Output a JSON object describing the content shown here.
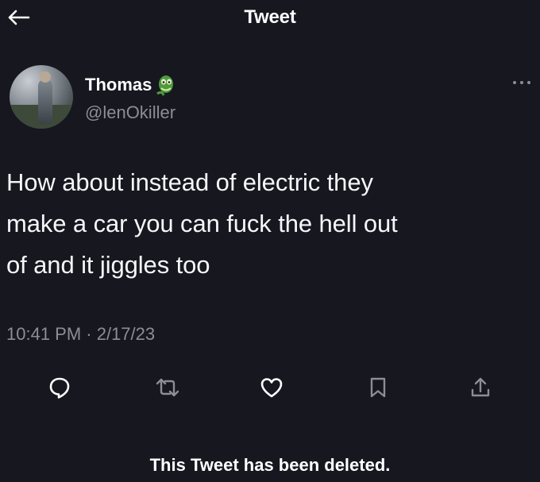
{
  "header": {
    "title": "Tweet",
    "back_icon": "arrow-left-icon"
  },
  "author": {
    "name": "Thomas",
    "handle": "@lenOkiller",
    "badge_icon": "green-creature-emoji-icon",
    "more_icon": "ellipsis-icon"
  },
  "tweet": {
    "lines": [
      "How about instead of electric they",
      "make a car you can fuck the hell out",
      "of and it jiggles too"
    ],
    "timestamp": "10:41 PM · 2/17/23"
  },
  "actions": {
    "icons": [
      "reply-icon",
      "retweet-icon",
      "like-icon",
      "bookmark-icon",
      "share-icon"
    ]
  },
  "notice": {
    "text": "This Tweet has been deleted."
  },
  "colors": {
    "background": "#16171f",
    "text": "#ffffff",
    "secondary_text": "#8b8e97"
  }
}
